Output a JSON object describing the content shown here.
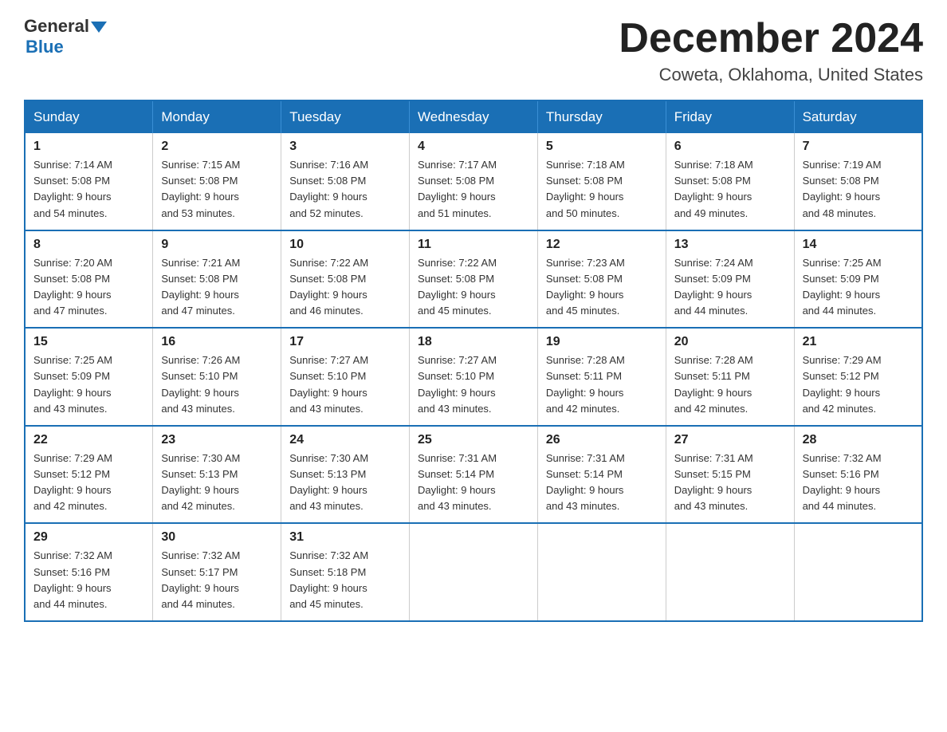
{
  "header": {
    "logo_general": "General",
    "logo_blue": "Blue",
    "month_title": "December 2024",
    "location": "Coweta, Oklahoma, United States"
  },
  "days_of_week": [
    "Sunday",
    "Monday",
    "Tuesday",
    "Wednesday",
    "Thursday",
    "Friday",
    "Saturday"
  ],
  "weeks": [
    [
      {
        "day": "1",
        "sunrise": "7:14 AM",
        "sunset": "5:08 PM",
        "daylight": "9 hours and 54 minutes."
      },
      {
        "day": "2",
        "sunrise": "7:15 AM",
        "sunset": "5:08 PM",
        "daylight": "9 hours and 53 minutes."
      },
      {
        "day": "3",
        "sunrise": "7:16 AM",
        "sunset": "5:08 PM",
        "daylight": "9 hours and 52 minutes."
      },
      {
        "day": "4",
        "sunrise": "7:17 AM",
        "sunset": "5:08 PM",
        "daylight": "9 hours and 51 minutes."
      },
      {
        "day": "5",
        "sunrise": "7:18 AM",
        "sunset": "5:08 PM",
        "daylight": "9 hours and 50 minutes."
      },
      {
        "day": "6",
        "sunrise": "7:18 AM",
        "sunset": "5:08 PM",
        "daylight": "9 hours and 49 minutes."
      },
      {
        "day": "7",
        "sunrise": "7:19 AM",
        "sunset": "5:08 PM",
        "daylight": "9 hours and 48 minutes."
      }
    ],
    [
      {
        "day": "8",
        "sunrise": "7:20 AM",
        "sunset": "5:08 PM",
        "daylight": "9 hours and 47 minutes."
      },
      {
        "day": "9",
        "sunrise": "7:21 AM",
        "sunset": "5:08 PM",
        "daylight": "9 hours and 47 minutes."
      },
      {
        "day": "10",
        "sunrise": "7:22 AM",
        "sunset": "5:08 PM",
        "daylight": "9 hours and 46 minutes."
      },
      {
        "day": "11",
        "sunrise": "7:22 AM",
        "sunset": "5:08 PM",
        "daylight": "9 hours and 45 minutes."
      },
      {
        "day": "12",
        "sunrise": "7:23 AM",
        "sunset": "5:08 PM",
        "daylight": "9 hours and 45 minutes."
      },
      {
        "day": "13",
        "sunrise": "7:24 AM",
        "sunset": "5:09 PM",
        "daylight": "9 hours and 44 minutes."
      },
      {
        "day": "14",
        "sunrise": "7:25 AM",
        "sunset": "5:09 PM",
        "daylight": "9 hours and 44 minutes."
      }
    ],
    [
      {
        "day": "15",
        "sunrise": "7:25 AM",
        "sunset": "5:09 PM",
        "daylight": "9 hours and 43 minutes."
      },
      {
        "day": "16",
        "sunrise": "7:26 AM",
        "sunset": "5:10 PM",
        "daylight": "9 hours and 43 minutes."
      },
      {
        "day": "17",
        "sunrise": "7:27 AM",
        "sunset": "5:10 PM",
        "daylight": "9 hours and 43 minutes."
      },
      {
        "day": "18",
        "sunrise": "7:27 AM",
        "sunset": "5:10 PM",
        "daylight": "9 hours and 43 minutes."
      },
      {
        "day": "19",
        "sunrise": "7:28 AM",
        "sunset": "5:11 PM",
        "daylight": "9 hours and 42 minutes."
      },
      {
        "day": "20",
        "sunrise": "7:28 AM",
        "sunset": "5:11 PM",
        "daylight": "9 hours and 42 minutes."
      },
      {
        "day": "21",
        "sunrise": "7:29 AM",
        "sunset": "5:12 PM",
        "daylight": "9 hours and 42 minutes."
      }
    ],
    [
      {
        "day": "22",
        "sunrise": "7:29 AM",
        "sunset": "5:12 PM",
        "daylight": "9 hours and 42 minutes."
      },
      {
        "day": "23",
        "sunrise": "7:30 AM",
        "sunset": "5:13 PM",
        "daylight": "9 hours and 42 minutes."
      },
      {
        "day": "24",
        "sunrise": "7:30 AM",
        "sunset": "5:13 PM",
        "daylight": "9 hours and 43 minutes."
      },
      {
        "day": "25",
        "sunrise": "7:31 AM",
        "sunset": "5:14 PM",
        "daylight": "9 hours and 43 minutes."
      },
      {
        "day": "26",
        "sunrise": "7:31 AM",
        "sunset": "5:14 PM",
        "daylight": "9 hours and 43 minutes."
      },
      {
        "day": "27",
        "sunrise": "7:31 AM",
        "sunset": "5:15 PM",
        "daylight": "9 hours and 43 minutes."
      },
      {
        "day": "28",
        "sunrise": "7:32 AM",
        "sunset": "5:16 PM",
        "daylight": "9 hours and 44 minutes."
      }
    ],
    [
      {
        "day": "29",
        "sunrise": "7:32 AM",
        "sunset": "5:16 PM",
        "daylight": "9 hours and 44 minutes."
      },
      {
        "day": "30",
        "sunrise": "7:32 AM",
        "sunset": "5:17 PM",
        "daylight": "9 hours and 44 minutes."
      },
      {
        "day": "31",
        "sunrise": "7:32 AM",
        "sunset": "5:18 PM",
        "daylight": "9 hours and 45 minutes."
      },
      null,
      null,
      null,
      null
    ]
  ],
  "labels": {
    "sunrise": "Sunrise:",
    "sunset": "Sunset:",
    "daylight": "Daylight:"
  }
}
